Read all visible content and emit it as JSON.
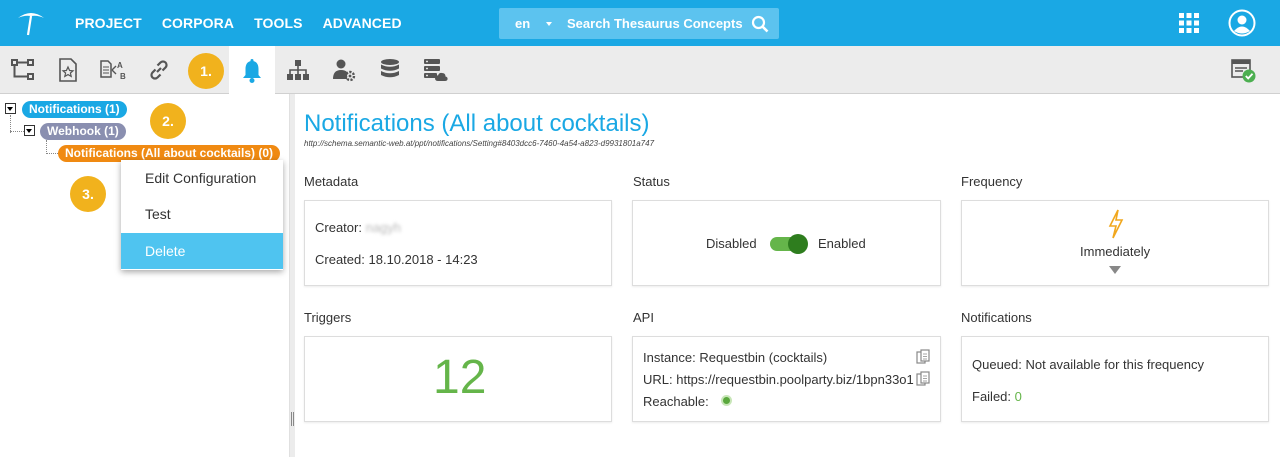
{
  "topbar": {
    "nav": [
      "PROJECT",
      "CORPORA",
      "TOOLS",
      "ADVANCED"
    ],
    "search": {
      "language": "en",
      "placeholder": "Search Thesaurus Concepts"
    }
  },
  "markers": {
    "m1": "1.",
    "m2": "2.",
    "m3": "3."
  },
  "tree": {
    "root": "Notifications (1)",
    "webhook": "Webhook (1)",
    "leaf": "Notifications (All about cocktails) (0)"
  },
  "context_menu": {
    "items": [
      "Edit Configuration",
      "Test",
      "Delete"
    ],
    "highlighted": "Delete"
  },
  "main": {
    "title": "Notifications (All about cocktails)",
    "uri": "http://schema.semantic-web.at/ppt/notifications/Setting#8403dcc6-7460-4a54-a823-d9931801a747",
    "metadata": {
      "label": "Metadata",
      "creator_label": "Creator:",
      "creator_value": "nagyh",
      "created_label": "Created:",
      "created_value": "18.10.2018 - 14:23"
    },
    "status": {
      "label": "Status",
      "disabled": "Disabled",
      "enabled": "Enabled",
      "state": "enabled"
    },
    "frequency": {
      "label": "Frequency",
      "value": "Immediately"
    },
    "triggers": {
      "label": "Triggers",
      "count": "12"
    },
    "api": {
      "label": "API",
      "instance": "Instance: Requestbin (cocktails)",
      "url": "URL: https://requestbin.poolparty.biz/1bpn33o1",
      "reachable": "Reachable:"
    },
    "notifications": {
      "label": "Notifications",
      "queued": "Queued: Not available for this frequency",
      "failed_label": "Failed:",
      "failed_value": "0"
    }
  },
  "colors": {
    "brand": "#1aa8e4",
    "marker": "#f1b21d",
    "root_pill": "#1aa8e4",
    "webhook_pill": "#8a8fb0",
    "leaf_pill": "#f08a12",
    "success": "#65b54a"
  }
}
